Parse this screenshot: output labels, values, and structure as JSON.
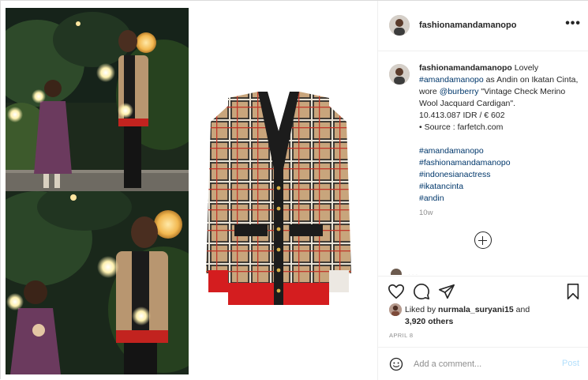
{
  "post": {
    "username": "fashionamandamanopo",
    "more_icon": "more-options-icon",
    "caption": {
      "username": "fashionamandamanopo",
      "text_before_mention": " Lovely ",
      "mention1": "#amandamanopo",
      "text_middle": " as Andin on Ikatan Cinta, wore ",
      "mention2": "@burberry",
      "text_after": " \"Vintage Check Merino Wool Jacquard Cardigan\".",
      "price": "10.413.087 IDR / € 602",
      "source": "• Source : farfetch.com",
      "hashtags": [
        "#amandamanopo",
        "#fashionamandamanopo",
        "#indonesianactress",
        "#ikatancinta",
        "#andin"
      ]
    },
    "time_ago": "10w",
    "cut_comment": "...",
    "likes": {
      "liked_by_prefix": "Liked by ",
      "liked_by_user": "nurmala_suryani15",
      "and_text": " and",
      "others": "3,920 others"
    },
    "date": "APRIL 8",
    "comment_input": {
      "placeholder": "Add a comment..."
    },
    "post_button": "Post"
  },
  "colors": {
    "link": "#00376b",
    "muted": "#8e8e8e",
    "post_disabled": "#b2dffc",
    "camel": "#c8a57c",
    "cardigan_red": "#d41d1f",
    "cardigan_black": "#1c1c1c"
  }
}
